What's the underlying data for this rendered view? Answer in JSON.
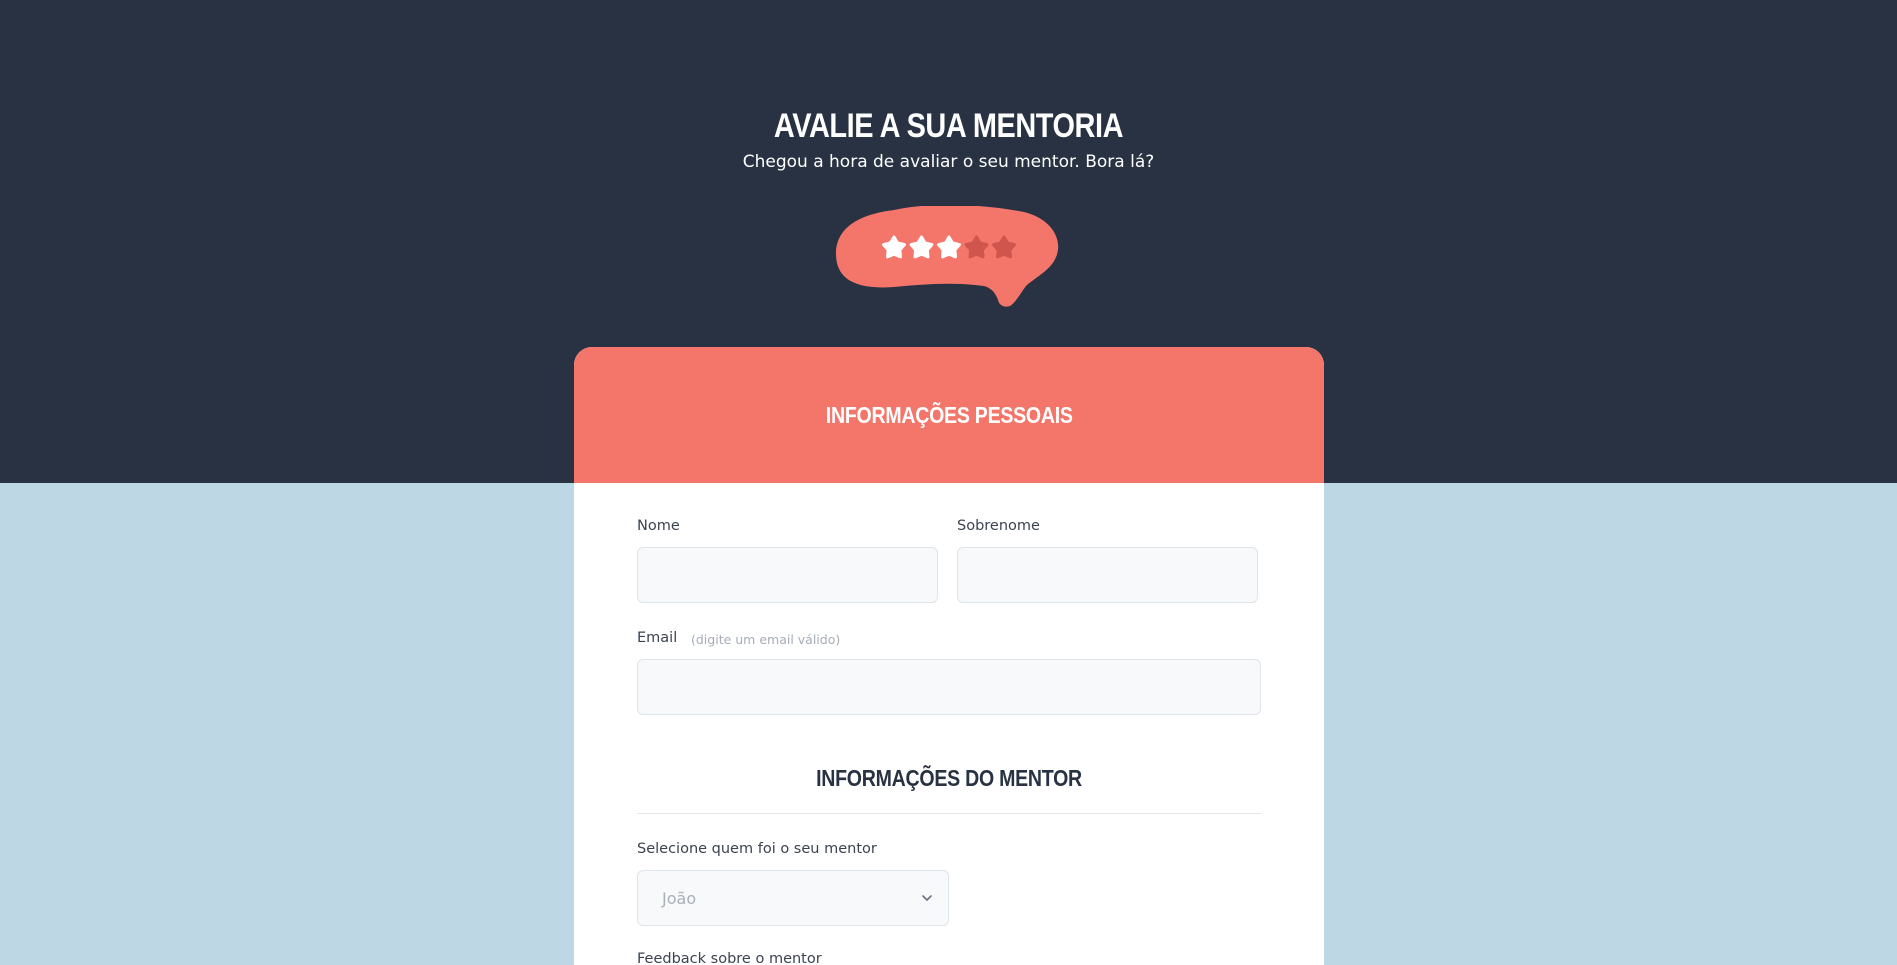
{
  "header": {
    "title": "AVALIE A SUA MENTORIA",
    "subtitle": "Chegou a hora de avaliar o seu mentor. Bora lá?"
  },
  "rating": {
    "value": 3,
    "max": 5,
    "bubble_color": "#f4766a",
    "active_star_color": "#ffffff",
    "inactive_star_color": "#d0564d"
  },
  "personal": {
    "title": "INFORMAÇÕES PESSOAIS",
    "first_name_label": "Nome",
    "first_name_value": "",
    "last_name_label": "Sobrenome",
    "last_name_value": "",
    "email_label": "Email",
    "email_hint": "(digite um email válido)",
    "email_value": ""
  },
  "mentor": {
    "title": "INFORMAÇÕES DO MENTOR",
    "select_label": "Selecione quem foi o seu mentor",
    "selected": "João",
    "feedback_label": "Feedback sobre o mentor"
  },
  "colors": {
    "top_background": "#283242",
    "bottom_background": "#bdd7e4",
    "accent": "#f4766a"
  }
}
